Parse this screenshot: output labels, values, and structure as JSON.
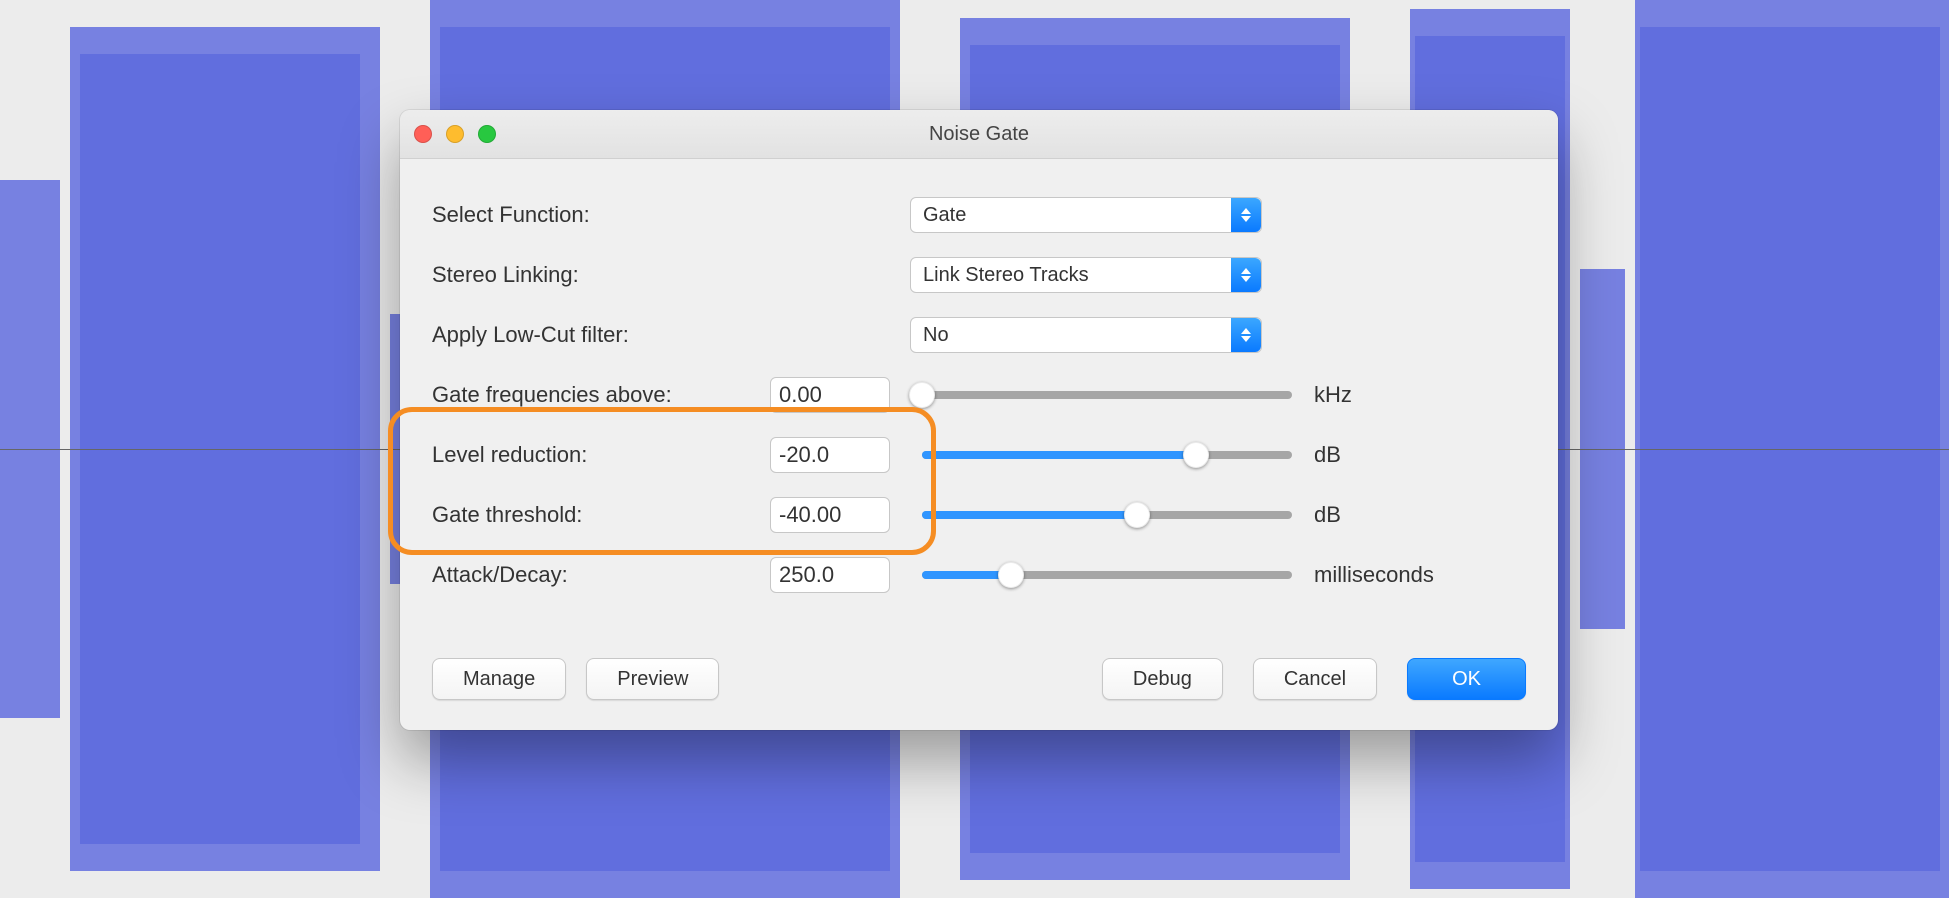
{
  "dialog": {
    "title": "Noise Gate",
    "select_function_label": "Select Function:",
    "select_function_value": "Gate",
    "stereo_linking_label": "Stereo Linking:",
    "stereo_linking_value": "Link Stereo Tracks",
    "lowcut_label": "Apply Low-Cut filter:",
    "lowcut_value": "No",
    "freq_label": "Gate frequencies above:",
    "freq_value": "0.00",
    "freq_unit": "kHz",
    "freq_slider_pct": 0,
    "level_label": "Level reduction:",
    "level_value": "-20.0",
    "level_unit": "dB",
    "level_slider_pct": 74,
    "thresh_label": "Gate threshold:",
    "thresh_value": "-40.00",
    "thresh_unit": "dB",
    "thresh_slider_pct": 58,
    "attack_label": "Attack/Decay:",
    "attack_value": "250.0",
    "attack_unit": "milliseconds",
    "attack_slider_pct": 24,
    "buttons": {
      "manage": "Manage",
      "preview": "Preview",
      "debug": "Debug",
      "cancel": "Cancel",
      "ok": "OK"
    }
  },
  "colors": {
    "accent": "#0a7aff",
    "highlight": "#f58d23"
  }
}
